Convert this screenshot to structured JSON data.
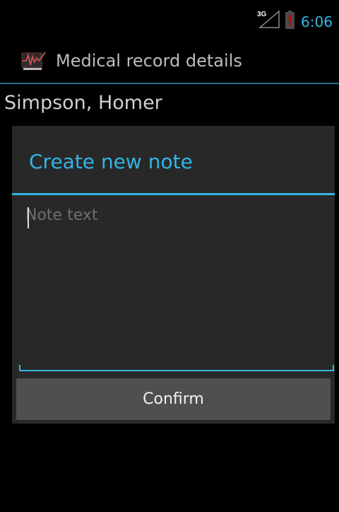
{
  "status_bar": {
    "network_label": "3G",
    "time": "6:06",
    "icons": [
      "signal-3g-icon",
      "battery-low-icon"
    ],
    "time_color": "#33b5e5",
    "battery_alert_color": "#cc0000"
  },
  "action_bar": {
    "title": "Medical record details",
    "icon": "medical-record-icon"
  },
  "patient": {
    "name": "Simpson, Homer"
  },
  "dialog": {
    "title": "Create new note",
    "note_value": "",
    "note_placeholder": "Note text",
    "confirm_label": "Confirm",
    "accent_color": "#33b5e5"
  }
}
